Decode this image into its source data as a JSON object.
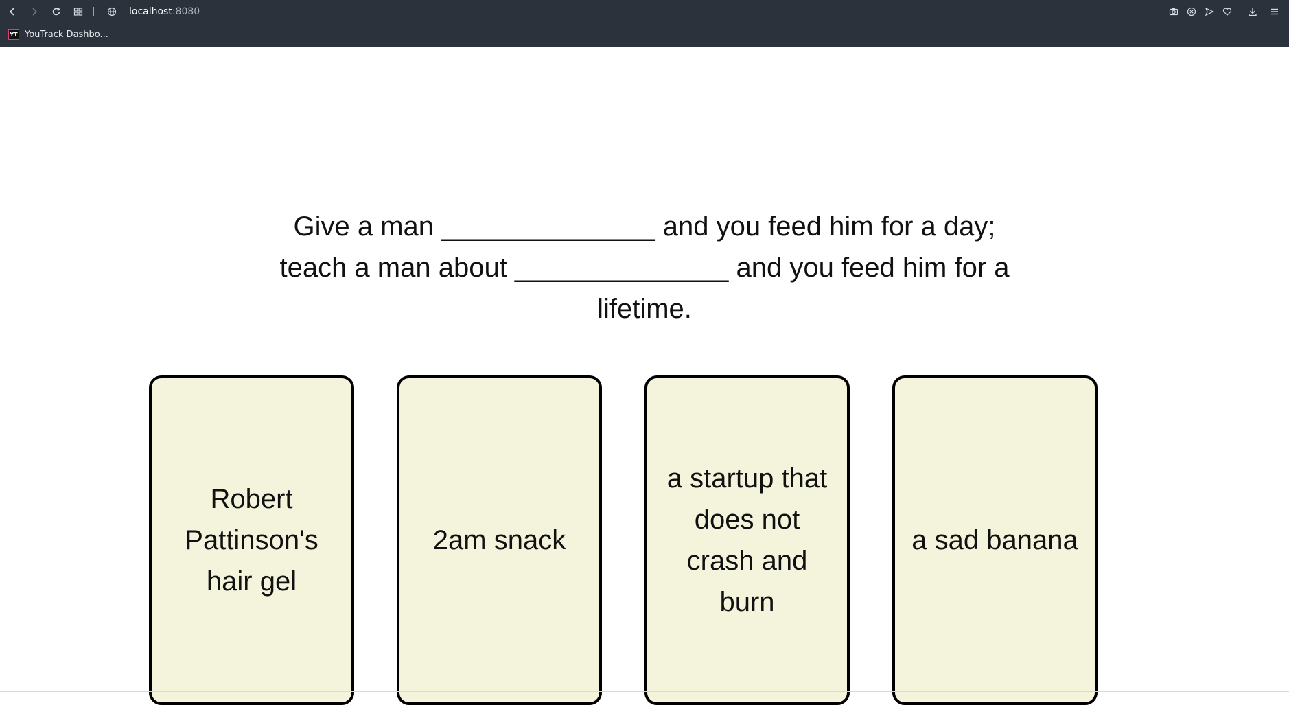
{
  "browser": {
    "url_host": "localhost",
    "url_port": ":8080",
    "bookmark_label": "YouTrack Dashbo...",
    "bookmark_favicon": "YT",
    "icons": {
      "back": "back-arrow-icon",
      "forward": "forward-arrow-icon",
      "reload": "reload-icon",
      "tabs": "grid-icon",
      "site": "globe-icon",
      "camera": "camera-icon",
      "shield": "shield-icon",
      "send": "send-icon",
      "heart": "heart-icon",
      "download": "download-icon",
      "menu": "menu-icon"
    }
  },
  "game": {
    "prompt": "Give a man ______________ and you feed him for a day; teach a man about ______________ and you feed him for a lifetime.",
    "cards": [
      {
        "text": "Robert Pattinson's hair gel"
      },
      {
        "text": "2am snack"
      },
      {
        "text": "a startup that does not crash and burn"
      },
      {
        "text": "a sad banana"
      }
    ]
  },
  "colors": {
    "chrome_bg": "#2b323b",
    "card_bg": "#f4f4dc",
    "card_border": "#000000",
    "text": "#111111"
  }
}
